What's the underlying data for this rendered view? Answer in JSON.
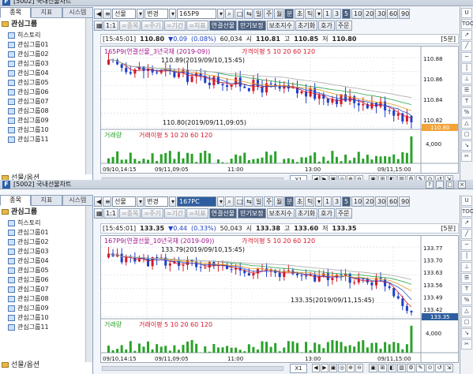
{
  "colors": {
    "up": "#d6182a",
    "down": "#1e3fc8",
    "accent": "#f2a33a",
    "highlight": "#ffd9a8",
    "green": "#2aa22a"
  },
  "win1": {
    "title": "[5002] 국내선물차트",
    "tabs": [
      "종목",
      "지표",
      "시스템"
    ],
    "group": "관심그룹",
    "items": [
      "히스토리",
      "관심그룹01",
      "관심그룹02",
      "관심그룹03",
      "관심그룹04",
      "관심그룹05",
      "관심그룹06",
      "관심그룹07",
      "관심그룹08",
      "관심그룹09",
      "관심그룹10",
      "관심그룹11"
    ],
    "footer_item": "선물/옵션",
    "toolbar": {
      "market": "선물",
      "change": "변경",
      "code": "165P9",
      "periods": [
        "일",
        "주",
        "월",
        "분",
        "초",
        "틱"
      ],
      "active_period": "분",
      "intervals": [
        "1",
        "3",
        "5",
        "10",
        "20",
        "30",
        "60",
        "90"
      ],
      "active_interval": "5"
    },
    "toolbar2": {
      "items": [
        "1:1",
        "=종목",
        "=주기",
        "=기간",
        "=지표",
        "연결선물",
        "만기보정",
        "보조지수",
        "초기화",
        "호가",
        "주문"
      ]
    },
    "quote": {
      "time": "[15:45:01]",
      "price": "110.80",
      "change": "▼0.09",
      "pct": "(0.08%)",
      "volume": "60,034",
      "open_label": "시",
      "open": "110.81",
      "high_label": "고",
      "high": "110.85",
      "low_label": "저",
      "low": "110.80",
      "period": "[5분]"
    },
    "legend": {
      "title": "165P9(연결선물_3년국채 (2019-09))",
      "ma_label": "가격이평",
      "mas": [
        "5",
        "10",
        "20",
        "60",
        "120"
      ]
    },
    "annotations": {
      "high": "110.89(2019/09/10,15:45)",
      "low": "110.80(2019/09/11,09:05)"
    },
    "y_ticks": [
      "110.88",
      "110.86",
      "110.84",
      "110.82"
    ],
    "price_tag": "110.80",
    "vol_legend": {
      "title": "거래량",
      "ma_label": "거래이평",
      "mas": [
        "5",
        "10",
        "20",
        "60",
        "120"
      ]
    },
    "vol_tick": "4,000",
    "x_ticks": [
      "09/10,14:15",
      "09/11,09:05",
      "11:00",
      "13:00",
      "09/11,15:00"
    ],
    "zoom": "X1"
  },
  "win2": {
    "title": "[5002] 국내선물차트",
    "tabs": [
      "종목",
      "지표",
      "시스템"
    ],
    "group": "관심그룹",
    "items": [
      "히스토리",
      "관심그룹01",
      "관심그룹02",
      "관심그룹03",
      "관심그룹04",
      "관심그룹05",
      "관심그룹06",
      "관심그룹07",
      "관심그룹08",
      "관심그룹09",
      "관심그룹10",
      "관심그룹11"
    ],
    "footer_item": "선물/옵션",
    "toolbar": {
      "market": "선물",
      "change": "변경",
      "code": "167PC",
      "periods": [
        "일",
        "주",
        "월",
        "분",
        "초",
        "틱"
      ],
      "active_period": "분",
      "intervals": [
        "1",
        "3",
        "5",
        "10",
        "20",
        "30",
        "60",
        "90"
      ],
      "active_interval": "5"
    },
    "toolbar2": {
      "items": [
        "1:1",
        "=종목",
        "=주기",
        "=기간",
        "=지표",
        "연결선물",
        "만기보정",
        "보조지수",
        "초기화",
        "호가",
        "주문"
      ]
    },
    "quote": {
      "time": "[15:45:01]",
      "price": "133.35",
      "change": "▼0.44",
      "pct": "(0.33%)",
      "volume": "50,043",
      "open_label": "시",
      "open": "133.38",
      "high_label": "고",
      "high": "133.60",
      "low_label": "저",
      "low": "133.35",
      "period": "[5분]"
    },
    "legend": {
      "title": "167P9(연결선물_10년국채 (2019-09))",
      "ma_label": "가격이평",
      "mas": [
        "5",
        "10",
        "20",
        "60",
        "120"
      ]
    },
    "annotations": {
      "high": "133.79(2019/09/10,15:45)",
      "low": "133.35(2019/09/11,15:45)"
    },
    "y_ticks": [
      "133.77",
      "133.70",
      "133.63",
      "133.56",
      "133.49",
      "133.42"
    ],
    "price_tag": "133.35",
    "vol_legend": {
      "title": "거래량",
      "ma_label": "거래이평",
      "mas": [
        "5",
        "10",
        "20",
        "60",
        "120"
      ]
    },
    "vol_tick": "4,000",
    "x_ticks": [
      "09/10,14:15",
      "09/11,09:05",
      "11:00",
      "13:00",
      "09/11,15:00"
    ],
    "zoom": "X1"
  },
  "right_tools": [
    "U",
    "TOOL",
    "↗",
    "╱",
    "─",
    "│",
    "⊥",
    "☰",
    "T",
    "%",
    "△",
    "▢",
    "↘",
    "✂"
  ]
}
